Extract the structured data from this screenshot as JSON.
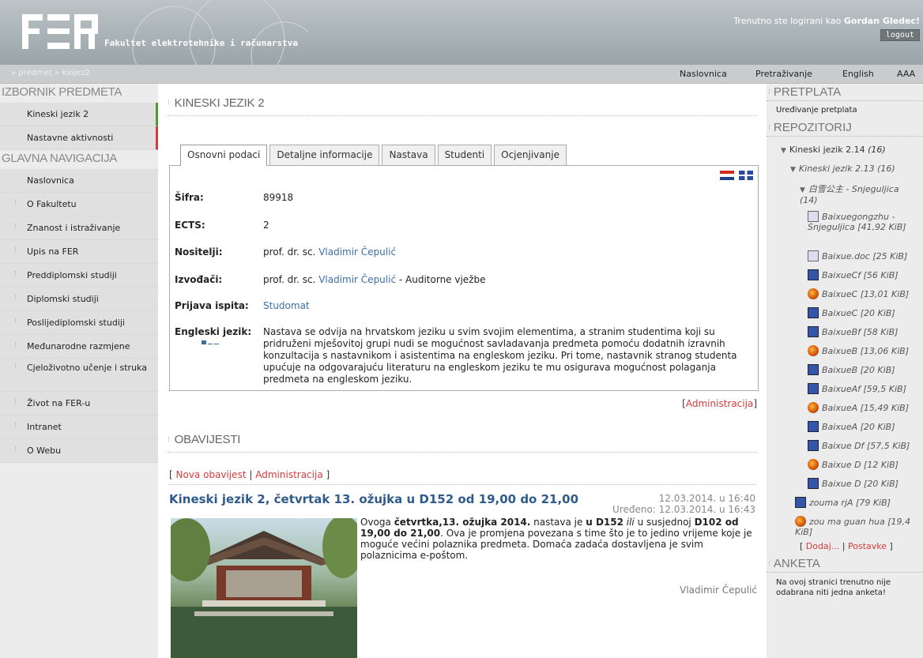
{
  "header": {
    "logo_text": "FER",
    "logo_subtitle": "Fakultet elektrotehnike i računarstva",
    "login_prefix": "Trenutno ste logirani kao",
    "user_name": "Gordan Gledec!",
    "logout_label": "logout"
  },
  "navbar": {
    "breadcrumb": "» predmet » kinjez2",
    "links": [
      "Naslovnica",
      "Pretraživanje",
      "English",
      "AAA"
    ]
  },
  "left": {
    "course_menu_title": "IZBORNIK PREDMETA",
    "course_items": [
      "Kineski jezik 2",
      "Nastavne aktivnosti"
    ],
    "main_nav_title": "GLAVNA NAVIGACIJA",
    "main_items": [
      "Naslovnica",
      "O Fakultetu",
      "Znanost i istraživanje",
      "Upis na FER",
      "Preddiplomski studiji",
      "Diplomski studiji",
      "Poslijediplomski studiji",
      "Međunarodne razmjene",
      "Cjeloživotno učenje i struka",
      "Život na FER-u",
      "Intranet",
      "O Webu"
    ]
  },
  "main": {
    "course_title": "KINESKI JEZIK 2",
    "tabs": [
      "Osnovni podaci",
      "Detaljne informacije",
      "Nastava",
      "Studenti",
      "Ocjenjivanje"
    ],
    "fields": {
      "sifra_label": "Šifra:",
      "sifra_value": "89918",
      "ects_label": "ECTS:",
      "ects_value": "2",
      "nositelji_label": "Nositelji:",
      "nositelji_prefix": "prof. dr. sc.",
      "nositelji_name": "Vladimir Čepulić",
      "izvodaci_label": "Izvođači:",
      "izvodaci_prefix": "prof. dr. sc.",
      "izvodaci_name": "Vladimir Čepulić",
      "izvodaci_suffix": "- Auditorne vježbe",
      "prijava_label": "Prijava ispita:",
      "prijava_value": "Studomat",
      "engleski_label": "Engleski jezik:",
      "engleski_text": "Nastava se odvija na hrvatskom jeziku u svim svojim elementima, a stranim studentima koji su pridruženi mješovitoj grupi nudi se mogućnost savladavanja predmeta pomoću dodatnih izravnih konzultacija s nastavnikom i asistentima na engleskom jeziku. Pri tome, nastavnik stranog studenta upućuje na odgovarajuću literaturu na engleskom jeziku te mu osigurava mogućnost polaganja predmeta na engleskom jeziku."
    },
    "administracija": "Administracija",
    "news_heading": "OBAVIJESTI",
    "nova_obavijest": "Nova obavijest",
    "news": {
      "title": "Kineski jezik 2, četvrtak 13. ožujka u D152 od 19,00 do 21,00",
      "date": "12.03.2014. u 16:40",
      "edited": "Uređeno: 12.03.2014. u 16:43",
      "body_1": "Ovoga ",
      "body_b1": "četvrtka,13. ožujka 2014.",
      "body_2": " nastava je ",
      "body_b2": "u D152",
      "body_i1": " ili",
      "body_3": " u susjednoj ",
      "body_b3": "D102 od 19,00 do 21,00",
      "body_4": ". Ova je promjena povezana s time što je to jedino vrijeme koje je moguće većini polaznika predmeta. Domaća zadaća dostavljena je svim  polaznicima e-poštom.",
      "author": "Vladimir Čepulić"
    }
  },
  "right": {
    "pretplata_title": "PRETPLATA",
    "pretplata_link": "Uređivanje pretplata",
    "repo_title": "REPOZITORIJ",
    "repo_root": "Kineski jezik 2.14",
    "repo_root_count": "(16)",
    "repo_sub": "Kineski jezik 2.13 (16)",
    "repo_folder": "白雪公主 - Snjeguljica (14)",
    "files": [
      {
        "name": "Baixuegongzhu - Snjeguljica [41,92 KiB]",
        "icon": "doc-icon"
      },
      {
        "name": "Baixue.doc [25 KiB]",
        "icon": "doc-icon"
      },
      {
        "name": "BaixueCf [56 KiB]",
        "icon": "word-icon"
      },
      {
        "name": "BaixueC [13,01 KiB]",
        "icon": "firefox-icon"
      },
      {
        "name": "BaixueC [20 KiB]",
        "icon": "word-icon"
      },
      {
        "name": "BaixueBf [58 KiB]",
        "icon": "word-icon"
      },
      {
        "name": "BaixueB [13,06 KiB]",
        "icon": "firefox-icon"
      },
      {
        "name": "BaixueB [20 KiB]",
        "icon": "word-icon"
      },
      {
        "name": "BaixueAf [59,5 KiB]",
        "icon": "word-icon"
      },
      {
        "name": "BaixueA [15,49 KiB]",
        "icon": "firefox-icon"
      },
      {
        "name": "BaixueA [20 KiB]",
        "icon": "word-icon"
      },
      {
        "name": "Baixue Df [57,5 KiB]",
        "icon": "word-icon"
      },
      {
        "name": "Baixue D [12 KiB]",
        "icon": "firefox-icon"
      },
      {
        "name": "Baixue D [20 KiB]",
        "icon": "word-icon"
      }
    ],
    "extra_files": [
      {
        "name": "zouma rjA [79 KiB]",
        "icon": "word-icon"
      },
      {
        "name": "zou ma guan hua [19,4 KiB]",
        "icon": "firefox-icon"
      }
    ],
    "dodaj": "Dodaj...",
    "postavke": "Postavke",
    "anketa_title": "ANKETA",
    "anketa_text": "Na ovoj stranici trenutno nije odabrana niti jedna anketa!"
  }
}
